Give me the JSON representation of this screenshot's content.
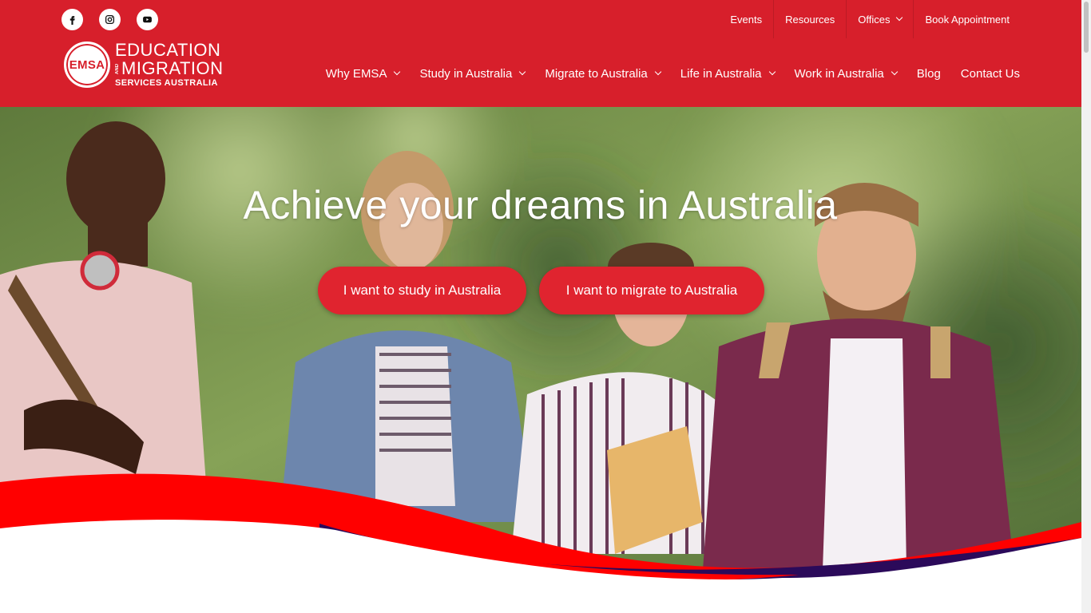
{
  "social": [
    {
      "icon": "facebook-icon"
    },
    {
      "icon": "instagram-icon"
    },
    {
      "icon": "youtube-icon"
    }
  ],
  "topnav": {
    "items": [
      {
        "label": "Events"
      },
      {
        "label": "Resources"
      },
      {
        "label": "Offices"
      },
      {
        "label": "Book Appointment"
      }
    ]
  },
  "logo": {
    "badge": "EMSA",
    "line1": "EDUCATION",
    "and": "AND",
    "line2": "MIGRATION",
    "line3": "SERVICES AUSTRALIA"
  },
  "mainnav": {
    "items": [
      {
        "label": "Why EMSA"
      },
      {
        "label": "Study in Australia"
      },
      {
        "label": "Migrate to Australia"
      },
      {
        "label": "Life in Australia"
      },
      {
        "label": "Work in Australia"
      },
      {
        "label": "Blog"
      },
      {
        "label": "Contact Us"
      }
    ]
  },
  "hero": {
    "title": "Achieve your dreams in Australia",
    "cta_study": "I want to study in Australia",
    "cta_migrate": "I want to migrate to Australia"
  },
  "colors": {
    "header": "#d71f2b",
    "cta": "#e0242f",
    "wave_red": "#ff0000",
    "wave_navy": "#2b0a5a"
  }
}
